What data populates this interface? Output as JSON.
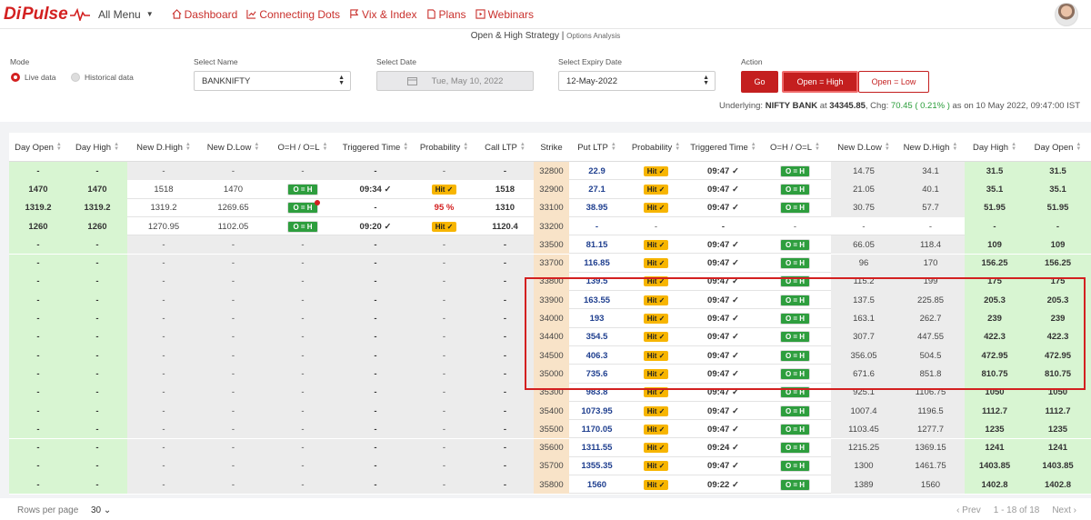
{
  "nav": {
    "logo_di": "Di",
    "logo_pulse": "Pulse",
    "all_menu": "All Menu",
    "links": [
      "Dashboard",
      "Connecting Dots",
      "Vix & Index",
      "Plans",
      "Webinars"
    ]
  },
  "panel": {
    "title": "Open & High Strategy",
    "subtitle": "Options Analysis",
    "mode_label": "Mode",
    "mode_live": "Live data",
    "mode_hist": "Historical data",
    "name_label": "Select Name",
    "name_value": "BANKNIFTY",
    "date_label": "Select Date",
    "date_value": "Tue, May 10, 2022",
    "expiry_label": "Select Expiry Date",
    "expiry_value": "12-May-2022",
    "action_label": "Action",
    "go": "Go",
    "open_high": "Open = High",
    "open_low": "Open = Low",
    "underlying_prefix": "Underlying:",
    "underlying_name": "NIFTY BANK",
    "at": "at",
    "underlying_price": "34345.85",
    "chg_label": ", Chg:",
    "chg_value": "70.45 ( 0.21% )",
    "as_on": "as on 10 May 2022, 09:47:00 IST"
  },
  "table": {
    "headers": [
      "Day Open",
      "Day High",
      "New D.High",
      "New D.Low",
      "O=H / O=L",
      "Triggered Time",
      "Probability",
      "Call LTP",
      "Strike",
      "Put LTP",
      "Probability",
      "Triggered Time",
      "O=H / O=L",
      "New D.Low",
      "New D.High",
      "Day High",
      "Day Open"
    ],
    "rows": [
      {
        "c": [
          "-",
          "-",
          "-",
          "-",
          "-",
          "-",
          "-",
          "-"
        ],
        "strike": "32800",
        "p": [
          "22.9",
          "Hit ✓",
          "09:47 ✓",
          "O = H",
          "14.75",
          "34.1",
          "31.5",
          "31.5"
        ]
      },
      {
        "c": [
          "1470",
          "1470",
          "1518",
          "1470",
          "O = H",
          "09:34 ✓",
          "Hit ✓",
          "1518"
        ],
        "strike": "32900",
        "p": [
          "27.1",
          "Hit ✓",
          "09:47 ✓",
          "O = H",
          "21.05",
          "40.1",
          "35.1",
          "35.1"
        ]
      },
      {
        "c": [
          "1319.2",
          "1319.2",
          "1319.2",
          "1269.65",
          "O = H",
          "-",
          "95 %",
          "1310"
        ],
        "strike": "33100",
        "p": [
          "38.95",
          "Hit ✓",
          "09:47 ✓",
          "O = H",
          "30.75",
          "57.7",
          "51.95",
          "51.95"
        ]
      },
      {
        "c": [
          "1260",
          "1260",
          "1270.95",
          "1102.05",
          "O = H",
          "09:20 ✓",
          "Hit ✓",
          "1120.4"
        ],
        "strike": "33200",
        "p": [
          "-",
          "-",
          "-",
          "-",
          "-",
          "-",
          "-",
          "-"
        ]
      },
      {
        "c": [
          "-",
          "-",
          "-",
          "-",
          "-",
          "-",
          "-",
          "-"
        ],
        "strike": "33500",
        "p": [
          "81.15",
          "Hit ✓",
          "09:47 ✓",
          "O = H",
          "66.05",
          "118.4",
          "109",
          "109"
        ]
      },
      {
        "c": [
          "-",
          "-",
          "-",
          "-",
          "-",
          "-",
          "-",
          "-"
        ],
        "strike": "33700",
        "p": [
          "116.85",
          "Hit ✓",
          "09:47 ✓",
          "O = H",
          "96",
          "170",
          "156.25",
          "156.25"
        ]
      },
      {
        "c": [
          "-",
          "-",
          "-",
          "-",
          "-",
          "-",
          "-",
          "-"
        ],
        "strike": "33800",
        "p": [
          "139.5",
          "Hit ✓",
          "09:47 ✓",
          "O = H",
          "115.2",
          "199",
          "175",
          "175"
        ]
      },
      {
        "c": [
          "-",
          "-",
          "-",
          "-",
          "-",
          "-",
          "-",
          "-"
        ],
        "strike": "33900",
        "p": [
          "163.55",
          "Hit ✓",
          "09:47 ✓",
          "O = H",
          "137.5",
          "225.85",
          "205.3",
          "205.3"
        ]
      },
      {
        "c": [
          "-",
          "-",
          "-",
          "-",
          "-",
          "-",
          "-",
          "-"
        ],
        "strike": "34000",
        "p": [
          "193",
          "Hit ✓",
          "09:47 ✓",
          "O = H",
          "163.1",
          "262.7",
          "239",
          "239"
        ]
      },
      {
        "c": [
          "-",
          "-",
          "-",
          "-",
          "-",
          "-",
          "-",
          "-"
        ],
        "strike": "34400",
        "p": [
          "354.5",
          "Hit ✓",
          "09:47 ✓",
          "O = H",
          "307.7",
          "447.55",
          "422.3",
          "422.3"
        ]
      },
      {
        "c": [
          "-",
          "-",
          "-",
          "-",
          "-",
          "-",
          "-",
          "-"
        ],
        "strike": "34500",
        "p": [
          "406.3",
          "Hit ✓",
          "09:47 ✓",
          "O = H",
          "356.05",
          "504.5",
          "472.95",
          "472.95"
        ]
      },
      {
        "c": [
          "-",
          "-",
          "-",
          "-",
          "-",
          "-",
          "-",
          "-"
        ],
        "strike": "35000",
        "p": [
          "735.6",
          "Hit ✓",
          "09:47 ✓",
          "O = H",
          "671.6",
          "851.8",
          "810.75",
          "810.75"
        ]
      },
      {
        "c": [
          "-",
          "-",
          "-",
          "-",
          "-",
          "-",
          "-",
          "-"
        ],
        "strike": "35300",
        "p": [
          "983.8",
          "Hit ✓",
          "09:47 ✓",
          "O = H",
          "925.1",
          "1106.75",
          "1050",
          "1050"
        ]
      },
      {
        "c": [
          "-",
          "-",
          "-",
          "-",
          "-",
          "-",
          "-",
          "-"
        ],
        "strike": "35400",
        "p": [
          "1073.95",
          "Hit ✓",
          "09:47 ✓",
          "O = H",
          "1007.4",
          "1196.5",
          "1112.7",
          "1112.7"
        ]
      },
      {
        "c": [
          "-",
          "-",
          "-",
          "-",
          "-",
          "-",
          "-",
          "-"
        ],
        "strike": "35500",
        "p": [
          "1170.05",
          "Hit ✓",
          "09:47 ✓",
          "O = H",
          "1103.45",
          "1277.7",
          "1235",
          "1235"
        ]
      },
      {
        "c": [
          "-",
          "-",
          "-",
          "-",
          "-",
          "-",
          "-",
          "-"
        ],
        "strike": "35600",
        "p": [
          "1311.55",
          "Hit ✓",
          "09:24 ✓",
          "O = H",
          "1215.25",
          "1369.15",
          "1241",
          "1241"
        ]
      },
      {
        "c": [
          "-",
          "-",
          "-",
          "-",
          "-",
          "-",
          "-",
          "-"
        ],
        "strike": "35700",
        "p": [
          "1355.35",
          "Hit ✓",
          "09:47 ✓",
          "O = H",
          "1300",
          "1461.75",
          "1403.85",
          "1403.85"
        ]
      },
      {
        "c": [
          "-",
          "-",
          "-",
          "-",
          "-",
          "-",
          "-",
          "-"
        ],
        "strike": "35800",
        "p": [
          "1560",
          "Hit ✓",
          "09:22 ✓",
          "O = H",
          "1389",
          "1560",
          "1402.8",
          "1402.8"
        ]
      }
    ]
  },
  "footer": {
    "rows_per_page": "Rows per page",
    "rows_value": "30",
    "prev": "‹ Prev",
    "range": "1 - 18 of 18",
    "next": "Next ›"
  }
}
